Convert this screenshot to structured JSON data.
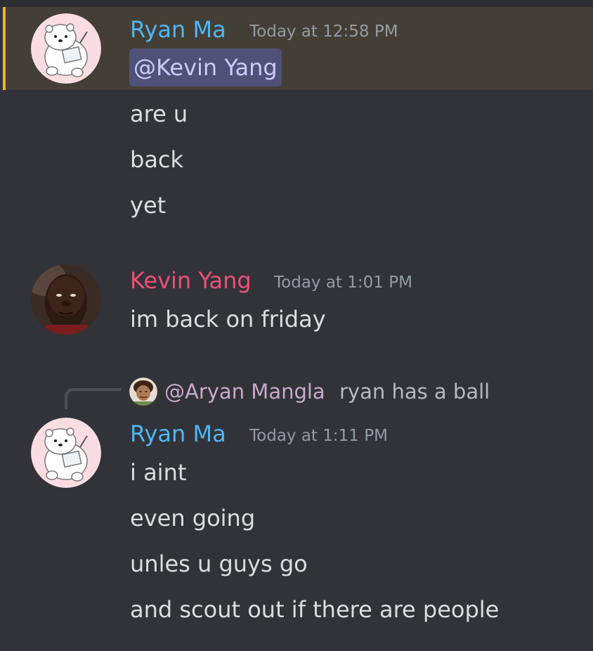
{
  "colors": {
    "background": "#313338",
    "mention_highlight": "#433f36",
    "mention_bar": "#f0b232",
    "ryan_name": "#4fb6f3",
    "kevin_name": "#ef4f78",
    "message_text": "#dbdee1",
    "timestamp": "#949ba4"
  },
  "messages": [
    {
      "author": "Ryan Ma",
      "timestamp": "Today at 12:58 PM",
      "avatar_icon": "polar-bear-avatar-icon",
      "mention": "@Kevin Yang",
      "lines": [
        "are u",
        "back",
        "yet"
      ]
    },
    {
      "author": "Kevin Yang",
      "timestamp": "Today at 1:01 PM",
      "avatar_icon": "kevin-avatar-icon",
      "lines": [
        "im back on friday"
      ]
    },
    {
      "author": "Ryan Ma",
      "timestamp": "Today at 1:11 PM",
      "avatar_icon": "polar-bear-avatar-icon",
      "reply": {
        "name": "@Aryan Mangla",
        "text": "ryan has a ball",
        "avatar_icon": "aryan-avatar-icon"
      },
      "lines": [
        "i aint",
        "even going",
        "unles u guys go",
        "and scout out if there are people"
      ]
    }
  ]
}
